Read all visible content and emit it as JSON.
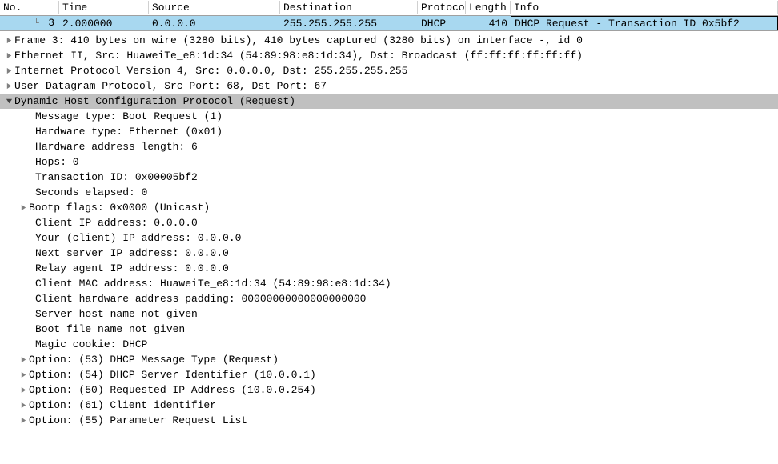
{
  "columns": {
    "no": "No.",
    "time": "Time",
    "source": "Source",
    "destination": "Destination",
    "protocol": "Protocol",
    "length": "Length",
    "info": "Info"
  },
  "packet": {
    "no": "3",
    "time": "2.000000",
    "source": "0.0.0.0",
    "destination": "255.255.255.255",
    "protocol": "DHCP",
    "length": "410",
    "info": "DHCP Request  - Transaction ID 0x5bf2"
  },
  "tree": {
    "frame": "Frame 3: 410 bytes on wire (3280 bits), 410 bytes captured (3280 bits) on interface -, id 0",
    "eth": "Ethernet II, Src: HuaweiTe_e8:1d:34 (54:89:98:e8:1d:34), Dst: Broadcast (ff:ff:ff:ff:ff:ff)",
    "ip": "Internet Protocol Version 4, Src: 0.0.0.0, Dst: 255.255.255.255",
    "udp": "User Datagram Protocol, Src Port: 68, Dst Port: 67",
    "dhcp": "Dynamic Host Configuration Protocol (Request)",
    "msgtype": "Message type: Boot Request (1)",
    "hwtype": "Hardware type: Ethernet (0x01)",
    "hwlen": "Hardware address length: 6",
    "hops": "Hops: 0",
    "xid": "Transaction ID: 0x00005bf2",
    "secs": "Seconds elapsed: 0",
    "flags": "Bootp flags: 0x0000 (Unicast)",
    "ciaddr": "Client IP address: 0.0.0.0",
    "yiaddr": "Your (client) IP address: 0.0.0.0",
    "siaddr": "Next server IP address: 0.0.0.0",
    "giaddr": "Relay agent IP address: 0.0.0.0",
    "chaddr": "Client MAC address: HuaweiTe_e8:1d:34 (54:89:98:e8:1d:34)",
    "chpad": "Client hardware address padding: 00000000000000000000",
    "sname": "Server host name not given",
    "file": "Boot file name not given",
    "cookie": "Magic cookie: DHCP",
    "opt53": "Option: (53) DHCP Message Type (Request)",
    "opt54": "Option: (54) DHCP Server Identifier (10.0.0.1)",
    "opt50": "Option: (50) Requested IP Address (10.0.0.254)",
    "opt61": "Option: (61) Client identifier",
    "opt55": "Option: (55) Parameter Request List"
  }
}
